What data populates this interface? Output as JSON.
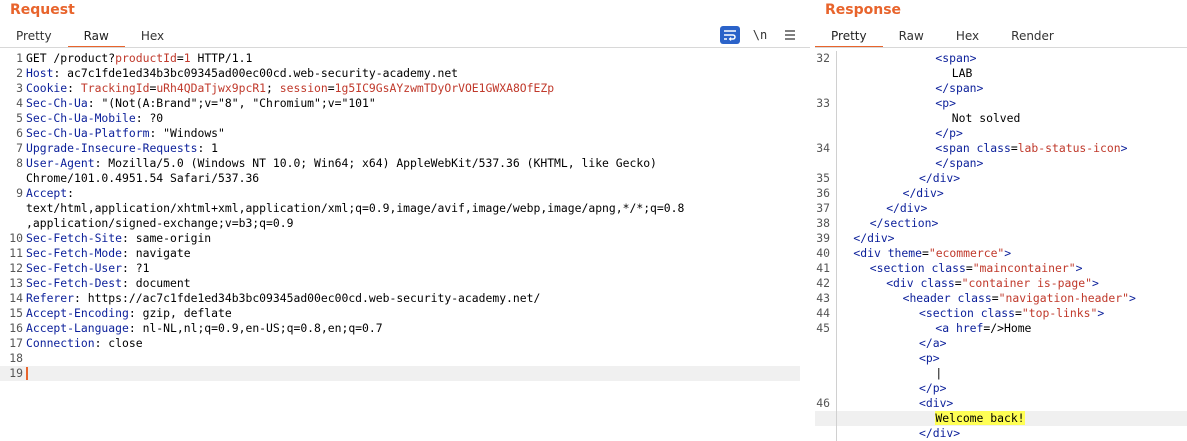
{
  "request": {
    "title": "Request",
    "tabs": [
      "Pretty",
      "Raw",
      "Hex"
    ],
    "active_tab": "Raw",
    "toolbar": {
      "wrap_icon": "wrap-lines-icon",
      "newline_label": "\\n",
      "menu_icon": "hamburger-menu-icon"
    },
    "lines": [
      {
        "n": "1",
        "segs": [
          [
            "v",
            "GET /product?"
          ],
          [
            "p",
            "productId"
          ],
          [
            "v",
            "="
          ],
          [
            "p",
            "1"
          ],
          [
            "v",
            " HTTP/1.1"
          ]
        ]
      },
      {
        "n": "2",
        "segs": [
          [
            "k",
            "Host"
          ],
          [
            "v",
            ": ac7c1fde1ed34b3bc09345ad00ec00cd.web-security-academy.net"
          ]
        ]
      },
      {
        "n": "3",
        "segs": [
          [
            "k",
            "Cookie"
          ],
          [
            "v",
            ": "
          ],
          [
            "p",
            "TrackingId"
          ],
          [
            "v",
            "="
          ],
          [
            "p",
            "uRh4QDaTjwx9pcR1"
          ],
          [
            "v",
            "; "
          ],
          [
            "p",
            "session"
          ],
          [
            "v",
            "="
          ],
          [
            "p",
            "1g5IC9GsAYzwmTDyOrVOE1GWXA8OfEZp"
          ]
        ]
      },
      {
        "n": "4",
        "segs": [
          [
            "k",
            "Sec-Ch-Ua"
          ],
          [
            "v",
            ": \"(Not(A:Brand\";v=\"8\", \"Chromium\";v=\"101\""
          ]
        ]
      },
      {
        "n": "5",
        "segs": [
          [
            "k",
            "Sec-Ch-Ua-Mobile"
          ],
          [
            "v",
            ": ?0"
          ]
        ]
      },
      {
        "n": "6",
        "segs": [
          [
            "k",
            "Sec-Ch-Ua-Platform"
          ],
          [
            "v",
            ": \"Windows\""
          ]
        ]
      },
      {
        "n": "7",
        "segs": [
          [
            "k",
            "Upgrade-Insecure-Requests"
          ],
          [
            "v",
            ": 1"
          ]
        ]
      },
      {
        "n": "8",
        "segs": [
          [
            "k",
            "User-Agent"
          ],
          [
            "v",
            ": Mozilla/5.0 (Windows NT 10.0; Win64; x64) AppleWebKit/537.36 (KHTML, like Gecko)"
          ]
        ]
      },
      {
        "n": "",
        "segs": [
          [
            "v",
            "Chrome/101.0.4951.54 Safari/537.36"
          ]
        ]
      },
      {
        "n": "9",
        "segs": [
          [
            "k",
            "Accept"
          ],
          [
            "v",
            ":"
          ]
        ]
      },
      {
        "n": "",
        "segs": [
          [
            "v",
            "text/html,application/xhtml+xml,application/xml;q=0.9,image/avif,image/webp,image/apng,*/*;q=0.8"
          ]
        ]
      },
      {
        "n": "",
        "segs": [
          [
            "v",
            ",application/signed-exchange;v=b3;q=0.9"
          ]
        ]
      },
      {
        "n": "10",
        "segs": [
          [
            "k",
            "Sec-Fetch-Site"
          ],
          [
            "v",
            ": same-origin"
          ]
        ]
      },
      {
        "n": "11",
        "segs": [
          [
            "k",
            "Sec-Fetch-Mode"
          ],
          [
            "v",
            ": navigate"
          ]
        ]
      },
      {
        "n": "12",
        "segs": [
          [
            "k",
            "Sec-Fetch-User"
          ],
          [
            "v",
            ": ?1"
          ]
        ]
      },
      {
        "n": "13",
        "segs": [
          [
            "k",
            "Sec-Fetch-Dest"
          ],
          [
            "v",
            ": document"
          ]
        ]
      },
      {
        "n": "14",
        "segs": [
          [
            "k",
            "Referer"
          ],
          [
            "v",
            ": https://ac7c1fde1ed34b3bc09345ad00ec00cd.web-security-academy.net/"
          ]
        ]
      },
      {
        "n": "15",
        "segs": [
          [
            "k",
            "Accept-Encoding"
          ],
          [
            "v",
            ": gzip, deflate"
          ]
        ]
      },
      {
        "n": "16",
        "segs": [
          [
            "k",
            "Accept-Language"
          ],
          [
            "v",
            ": nl-NL,nl;q=0.9,en-US;q=0.8,en;q=0.7"
          ]
        ]
      },
      {
        "n": "17",
        "segs": [
          [
            "k",
            "Connection"
          ],
          [
            "v",
            ": close"
          ]
        ]
      },
      {
        "n": "18",
        "segs": []
      },
      {
        "n": "19",
        "segs": [],
        "current": true
      }
    ]
  },
  "response": {
    "title": "Response",
    "tabs": [
      "Pretty",
      "Raw",
      "Hex",
      "Render"
    ],
    "active_tab": "Pretty",
    "lines": [
      {
        "n": "32",
        "indent": 12,
        "segs": [
          [
            "tag",
            "<span>"
          ]
        ]
      },
      {
        "n": "",
        "indent": 14,
        "segs": [
          [
            "v",
            "LAB"
          ]
        ]
      },
      {
        "n": "",
        "indent": 12,
        "segs": [
          [
            "tag",
            "</span>"
          ]
        ]
      },
      {
        "n": "33",
        "indent": 12,
        "segs": [
          [
            "tag",
            "<p>"
          ]
        ]
      },
      {
        "n": "",
        "indent": 14,
        "segs": [
          [
            "v",
            "Not solved"
          ]
        ]
      },
      {
        "n": "",
        "indent": 12,
        "segs": [
          [
            "tag",
            "</p>"
          ]
        ]
      },
      {
        "n": "34",
        "indent": 12,
        "segs": [
          [
            "tag",
            "<span "
          ],
          [
            "attr",
            "class"
          ],
          [
            "v",
            "="
          ],
          [
            "sval",
            "lab-status-icon"
          ],
          [
            "tag",
            ">"
          ]
        ]
      },
      {
        "n": "",
        "indent": 12,
        "segs": [
          [
            "tag",
            "</span>"
          ]
        ]
      },
      {
        "n": "35",
        "indent": 10,
        "segs": [
          [
            "tag",
            "</div>"
          ]
        ]
      },
      {
        "n": "36",
        "indent": 8,
        "segs": [
          [
            "tag",
            "</div>"
          ]
        ]
      },
      {
        "n": "37",
        "indent": 6,
        "segs": [
          [
            "tag",
            "</div>"
          ]
        ]
      },
      {
        "n": "38",
        "indent": 4,
        "segs": [
          [
            "tag",
            "</section>"
          ]
        ]
      },
      {
        "n": "39",
        "indent": 2,
        "segs": [
          [
            "tag",
            "</div>"
          ]
        ]
      },
      {
        "n": "40",
        "indent": 2,
        "segs": [
          [
            "tag",
            "<div "
          ],
          [
            "attr",
            "theme"
          ],
          [
            "v",
            "="
          ],
          [
            "sval",
            "\"ecommerce\""
          ],
          [
            "tag",
            ">"
          ]
        ]
      },
      {
        "n": "41",
        "indent": 4,
        "segs": [
          [
            "tag",
            "<section "
          ],
          [
            "attr",
            "class"
          ],
          [
            "v",
            "="
          ],
          [
            "sval",
            "\"maincontainer\""
          ],
          [
            "tag",
            ">"
          ]
        ]
      },
      {
        "n": "42",
        "indent": 6,
        "segs": [
          [
            "tag",
            "<div "
          ],
          [
            "attr",
            "class"
          ],
          [
            "v",
            "="
          ],
          [
            "sval",
            "\"container is-page\""
          ],
          [
            "tag",
            ">"
          ]
        ]
      },
      {
        "n": "43",
        "indent": 8,
        "segs": [
          [
            "tag",
            "<header "
          ],
          [
            "attr",
            "class"
          ],
          [
            "v",
            "="
          ],
          [
            "sval",
            "\"navigation-header\""
          ],
          [
            "tag",
            ">"
          ]
        ]
      },
      {
        "n": "44",
        "indent": 10,
        "segs": [
          [
            "tag",
            "<section "
          ],
          [
            "attr",
            "class"
          ],
          [
            "v",
            "="
          ],
          [
            "sval",
            "\"top-links\""
          ],
          [
            "tag",
            ">"
          ]
        ]
      },
      {
        "n": "45",
        "indent": 12,
        "segs": [
          [
            "tag",
            "<a "
          ],
          [
            "attr",
            "href"
          ],
          [
            "v",
            "=/>Home"
          ]
        ]
      },
      {
        "n": "",
        "indent": 10,
        "segs": [
          [
            "tag",
            "</a>"
          ]
        ]
      },
      {
        "n": "",
        "indent": 10,
        "segs": [
          [
            "tag",
            "<p>"
          ]
        ]
      },
      {
        "n": "",
        "indent": 12,
        "segs": [
          [
            "v",
            "|"
          ]
        ]
      },
      {
        "n": "",
        "indent": 10,
        "segs": [
          [
            "tag",
            "</p>"
          ]
        ]
      },
      {
        "n": "46",
        "indent": 10,
        "segs": [
          [
            "tag",
            "<div>"
          ]
        ]
      },
      {
        "n": "",
        "indent": 12,
        "segs": [
          [
            "hl",
            "Welcome back!"
          ]
        ],
        "current": true
      },
      {
        "n": "",
        "indent": 10,
        "segs": [
          [
            "tag",
            "</div>"
          ]
        ]
      }
    ]
  }
}
